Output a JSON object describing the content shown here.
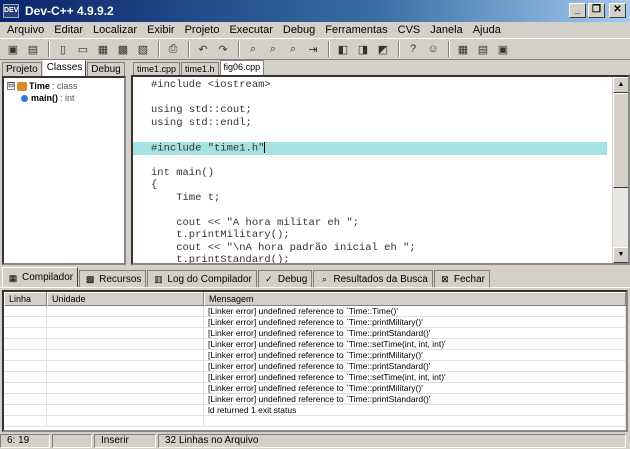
{
  "window": {
    "title": "Dev-C++ 4.9.9.2",
    "app_icon": "DEV",
    "buttons": [
      "_",
      "❐",
      "✕"
    ]
  },
  "menu": [
    "Arquivo",
    "Editar",
    "Localizar",
    "Exibir",
    "Projeto",
    "Executar",
    "Debug",
    "Ferramentas",
    "CVS",
    "Janela",
    "Ajuda"
  ],
  "left_panel": {
    "tabs": [
      "Projeto",
      "Classes",
      "Debug"
    ],
    "active_tab": "Classes",
    "tree": {
      "class_name": "Time",
      "class_kind": ": class",
      "expander": "⊟",
      "method_name": "main()",
      "method_type": ": int"
    }
  },
  "editor": {
    "tabs": [
      "time1.cpp",
      "time1.h",
      "fig06.cpp"
    ],
    "active_tab": "fig06.cpp",
    "lines": [
      "#include <iostream>",
      "",
      "using std::cout;",
      "using std::endl;",
      "",
      "#include \"time1.h\"",
      "",
      "int main()",
      "{",
      "    Time t;",
      "",
      "    cout << \"A hora militar eh \";",
      "    t.printMilitary();",
      "    cout << \"\\nA hora padrão inicial eh \";",
      "    t.printStandard();"
    ],
    "highlighted_line": 5
  },
  "bottom_tabs": [
    {
      "label": "Compilador",
      "icon": "compiler-icon"
    },
    {
      "label": "Recursos",
      "icon": "resources-icon"
    },
    {
      "label": "Log do Compilador",
      "icon": "compile-log-icon"
    },
    {
      "label": "Debug",
      "icon": "debug-icon"
    },
    {
      "label": "Resultados da Busca",
      "icon": "search-results-icon"
    },
    {
      "label": "Fechar",
      "icon": "close-icon"
    }
  ],
  "messages": {
    "headers": {
      "line": "Linha",
      "unit": "Unidade",
      "message": "Mensagem"
    },
    "rows": [
      "[Linker error] undefined reference to `Time::Time()'",
      "[Linker error] undefined reference to `Time::printMilitary()'",
      "[Linker error] undefined reference to `Time::printStandard()'",
      "[Linker error] undefined reference to `Time::setTime(int, int, int)'",
      "[Linker error] undefined reference to `Time::printMilitary()'",
      "[Linker error] undefined reference to `Time::printStandard()'",
      "[Linker error] undefined reference to `Time::setTime(int, int, int)'",
      "[Linker error] undefined reference to `Time::printMilitary()'",
      "[Linker error] undefined reference to `Time::printStandard()'",
      "ld returned 1 exit status"
    ]
  },
  "status": {
    "position": "6: 19",
    "modified": "",
    "mode": "Inserir",
    "info": "32 Linhas no Arquivo"
  }
}
